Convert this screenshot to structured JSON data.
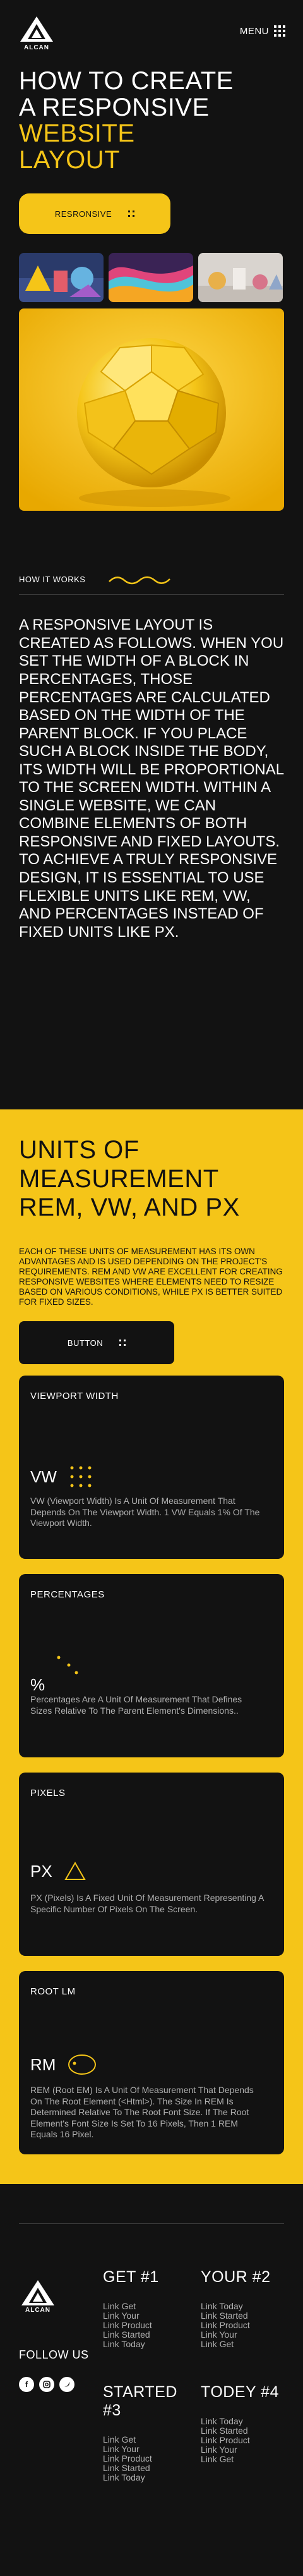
{
  "header": {
    "logo_text": "ALCAN",
    "menu_label": "MENU"
  },
  "hero": {
    "title_line1": "HOW TO CREATE",
    "title_line2": "A RESPONSIVE",
    "title_accent1": "WEBSITE",
    "title_accent2": "LAYOUT",
    "cta_label": "RESRONSIVE"
  },
  "how": {
    "label": "HOW IT WORKS",
    "text": "A RESPONSIVE LAYOUT IS CREATED AS FOLLOWS. WHEN YOU SET THE WIDTH OF A BLOCK IN PERCENTAGES, THOSE PERCENTAGES ARE CALCULATED BASED ON THE WIDTH OF THE PARENT BLOCK. IF YOU PLACE SUCH A BLOCK INSIDE THE BODY, ITS WIDTH WILL BE PROPORTIONAL TO THE SCREEN WIDTH. WITHIN A SINGLE WEBSITE, WE CAN COMBINE ELEMENTS OF BOTH RESPONSIVE AND FIXED LAYOUTS. TO ACHIEVE A TRULY RESPONSIVE DESIGN, IT IS ESSENTIAL TO USE FLEXIBLE UNITS LIKE REM, VW, AND PERCENTAGES INSTEAD OF FIXED UNITS LIKE PX."
  },
  "units": {
    "title_line1": "UNITS OF",
    "title_line2": "MEASUREMENT",
    "title_line3": "REM, VW, AND PX",
    "text": "EACH OF THESE UNITS OF MEASUREMENT HAS ITS OWN ADVANTAGES AND IS USED DEPENDING ON THE PROJECT'S REQUIREMENTS. REM AND VW ARE EXCELLENT FOR CREATING RESPONSIVE WEBSITES WHERE ELEMENTS NEED TO RESIZE BASED ON VARIOUS CONDITIONS, WHILE PX IS BETTER SUITED FOR FIXED SIZES.",
    "button_label": "BUTTON",
    "cards": [
      {
        "head": "VIEWPORT WIDTH",
        "symbol": "VW",
        "icon": "dot-grid-icon",
        "desc": "VW (Viewport Width) Is A Unit Of Measurement That Depends On The Viewport Width. 1 VW Equals 1% Of The Viewport Width."
      },
      {
        "head": "PERCENTAGES",
        "symbol": "%",
        "icon": "scattered-dots-icon",
        "desc": "Percentages Are A Unit Of Measurement That Defines Sizes Relative To The Parent Element's Dimensions.."
      },
      {
        "head": "PIXELS",
        "symbol": "PX",
        "icon": "triangle-icon",
        "desc": "PX (Pixels) Is A Fixed Unit Of Measurement Representing A Specific Number Of Pixels On The Screen."
      },
      {
        "head": "ROOT LM",
        "symbol": "RM",
        "icon": "ellipse-icon",
        "desc": "REM (Root EM) Is A Unit Of Measurement That Depends On The Root Element (<Html>). The Size In REM Is Determined Relative To The Root Font Size. If The Root Element's Font Size Is Set To 16 Pixels, Then 1 REM Equals 16 Pixel."
      }
    ]
  },
  "footer": {
    "logo_text": "ALCAN",
    "follow": "FOLLOW US",
    "columns": [
      {
        "title": "GET #1",
        "links": [
          "Link Get",
          "Link Your",
          "Link Product",
          "Link Started",
          "Link Today"
        ]
      },
      {
        "title": "YOUR #2",
        "links": [
          "Link Today",
          "Link Started",
          "Link Product",
          "Link Your",
          "Link Get"
        ]
      },
      {
        "title": "STARTED #3",
        "links": [
          "Link Get",
          "Link Your",
          "Link Product",
          "Link Started",
          "Link Today"
        ]
      },
      {
        "title": "TODEY #4",
        "links": [
          "Link Today",
          "Link Started",
          "Link Product",
          "Link Your",
          "Link Get"
        ]
      }
    ]
  },
  "colors": {
    "accent": "#f5c518",
    "background": "#121212",
    "text": "#ffffff",
    "muted": "#b0b0b0"
  }
}
